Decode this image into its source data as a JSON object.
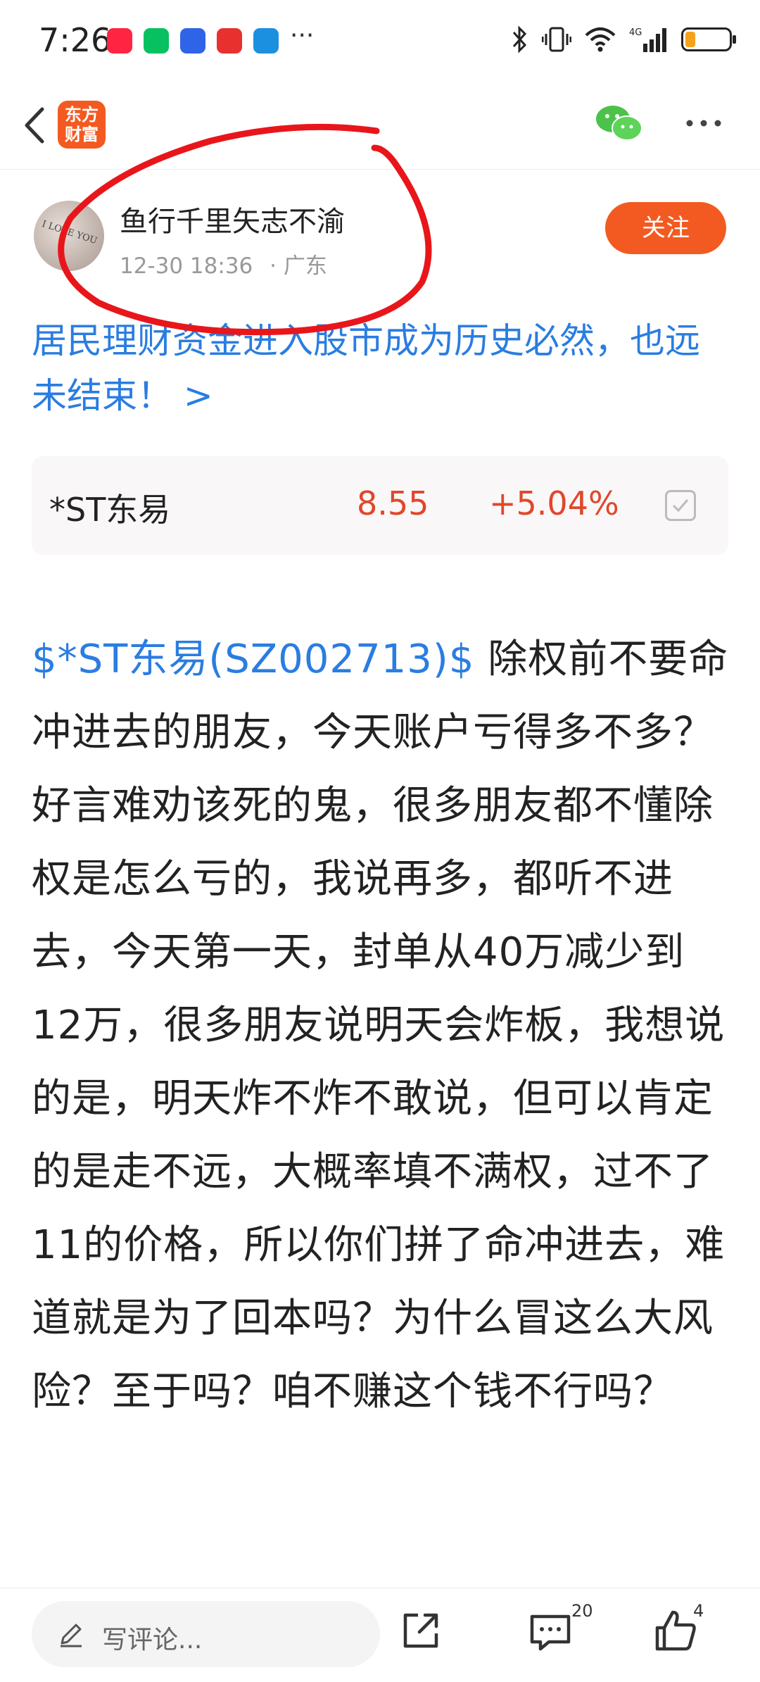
{
  "status_bar": {
    "time": "7:26",
    "more": "···",
    "apps": [
      {
        "name": "xiaohongshu-icon",
        "color": "#ff2442",
        "label": "小红书"
      },
      {
        "name": "wechat-app-icon",
        "color": "#07c160"
      },
      {
        "name": "app-icon-blue",
        "color": "#2f64e8"
      },
      {
        "name": "app-icon-red",
        "color": "#e8302f"
      },
      {
        "name": "app-icon-teal",
        "color": "#1b8fe0"
      }
    ],
    "network": "4G"
  },
  "nav": {
    "logo_line1": "东方",
    "logo_line2": "财富"
  },
  "author": {
    "name": "鱼行千里矢志不渝",
    "time": "12-30 18:36",
    "location": "· 广东",
    "avatar_text": "I LOVE YOU",
    "follow_label": "关注"
  },
  "headline": "居民理财资金进入股市成为历史必然，也远未结束！ >",
  "stock": {
    "name": "*ST东易",
    "price": "8.55",
    "change": "+5.04%"
  },
  "article": {
    "tag": "$*ST东易(SZ002713)$",
    "body": " 除权前不要命冲进去的朋友，今天账户亏得多不多？好言难劝该死的鬼，很多朋友都不懂除权是怎么亏的，我说再多，都听不进去，今天第一天，封单从40万减少到12万，很多朋友说明天会炸板，我想说的是，明天炸不炸不敢说，但可以肯定的是走不远，大概率填不满权，过不了11的价格，所以你们拼了命冲进去，难道就是为了回本吗？为什么冒这么大风险？至于吗？咱不赚这个钱不行吗？"
  },
  "bottom_bar": {
    "comment_placeholder": "写评论...",
    "comment_count": "20",
    "like_count": "4"
  },
  "colors": {
    "accent": "#f35a21",
    "link": "#2a7de1",
    "up": "#e0472b",
    "annotation": "#e8161b"
  }
}
